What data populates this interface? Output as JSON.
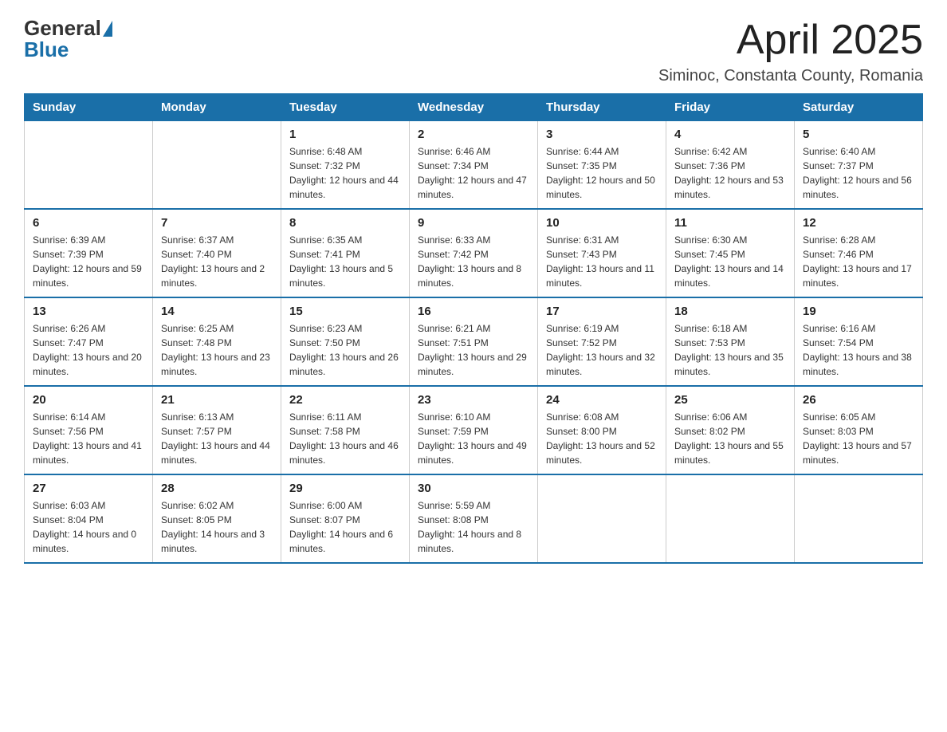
{
  "header": {
    "title": "April 2025",
    "subtitle": "Siminoc, Constanta County, Romania"
  },
  "logo": {
    "general": "General",
    "blue": "Blue"
  },
  "days_of_week": [
    "Sunday",
    "Monday",
    "Tuesday",
    "Wednesday",
    "Thursday",
    "Friday",
    "Saturday"
  ],
  "weeks": [
    [
      {
        "day": "",
        "sunrise": "",
        "sunset": "",
        "daylight": ""
      },
      {
        "day": "",
        "sunrise": "",
        "sunset": "",
        "daylight": ""
      },
      {
        "day": "1",
        "sunrise": "Sunrise: 6:48 AM",
        "sunset": "Sunset: 7:32 PM",
        "daylight": "Daylight: 12 hours and 44 minutes."
      },
      {
        "day": "2",
        "sunrise": "Sunrise: 6:46 AM",
        "sunset": "Sunset: 7:34 PM",
        "daylight": "Daylight: 12 hours and 47 minutes."
      },
      {
        "day": "3",
        "sunrise": "Sunrise: 6:44 AM",
        "sunset": "Sunset: 7:35 PM",
        "daylight": "Daylight: 12 hours and 50 minutes."
      },
      {
        "day": "4",
        "sunrise": "Sunrise: 6:42 AM",
        "sunset": "Sunset: 7:36 PM",
        "daylight": "Daylight: 12 hours and 53 minutes."
      },
      {
        "day": "5",
        "sunrise": "Sunrise: 6:40 AM",
        "sunset": "Sunset: 7:37 PM",
        "daylight": "Daylight: 12 hours and 56 minutes."
      }
    ],
    [
      {
        "day": "6",
        "sunrise": "Sunrise: 6:39 AM",
        "sunset": "Sunset: 7:39 PM",
        "daylight": "Daylight: 12 hours and 59 minutes."
      },
      {
        "day": "7",
        "sunrise": "Sunrise: 6:37 AM",
        "sunset": "Sunset: 7:40 PM",
        "daylight": "Daylight: 13 hours and 2 minutes."
      },
      {
        "day": "8",
        "sunrise": "Sunrise: 6:35 AM",
        "sunset": "Sunset: 7:41 PM",
        "daylight": "Daylight: 13 hours and 5 minutes."
      },
      {
        "day": "9",
        "sunrise": "Sunrise: 6:33 AM",
        "sunset": "Sunset: 7:42 PM",
        "daylight": "Daylight: 13 hours and 8 minutes."
      },
      {
        "day": "10",
        "sunrise": "Sunrise: 6:31 AM",
        "sunset": "Sunset: 7:43 PM",
        "daylight": "Daylight: 13 hours and 11 minutes."
      },
      {
        "day": "11",
        "sunrise": "Sunrise: 6:30 AM",
        "sunset": "Sunset: 7:45 PM",
        "daylight": "Daylight: 13 hours and 14 minutes."
      },
      {
        "day": "12",
        "sunrise": "Sunrise: 6:28 AM",
        "sunset": "Sunset: 7:46 PM",
        "daylight": "Daylight: 13 hours and 17 minutes."
      }
    ],
    [
      {
        "day": "13",
        "sunrise": "Sunrise: 6:26 AM",
        "sunset": "Sunset: 7:47 PM",
        "daylight": "Daylight: 13 hours and 20 minutes."
      },
      {
        "day": "14",
        "sunrise": "Sunrise: 6:25 AM",
        "sunset": "Sunset: 7:48 PM",
        "daylight": "Daylight: 13 hours and 23 minutes."
      },
      {
        "day": "15",
        "sunrise": "Sunrise: 6:23 AM",
        "sunset": "Sunset: 7:50 PM",
        "daylight": "Daylight: 13 hours and 26 minutes."
      },
      {
        "day": "16",
        "sunrise": "Sunrise: 6:21 AM",
        "sunset": "Sunset: 7:51 PM",
        "daylight": "Daylight: 13 hours and 29 minutes."
      },
      {
        "day": "17",
        "sunrise": "Sunrise: 6:19 AM",
        "sunset": "Sunset: 7:52 PM",
        "daylight": "Daylight: 13 hours and 32 minutes."
      },
      {
        "day": "18",
        "sunrise": "Sunrise: 6:18 AM",
        "sunset": "Sunset: 7:53 PM",
        "daylight": "Daylight: 13 hours and 35 minutes."
      },
      {
        "day": "19",
        "sunrise": "Sunrise: 6:16 AM",
        "sunset": "Sunset: 7:54 PM",
        "daylight": "Daylight: 13 hours and 38 minutes."
      }
    ],
    [
      {
        "day": "20",
        "sunrise": "Sunrise: 6:14 AM",
        "sunset": "Sunset: 7:56 PM",
        "daylight": "Daylight: 13 hours and 41 minutes."
      },
      {
        "day": "21",
        "sunrise": "Sunrise: 6:13 AM",
        "sunset": "Sunset: 7:57 PM",
        "daylight": "Daylight: 13 hours and 44 minutes."
      },
      {
        "day": "22",
        "sunrise": "Sunrise: 6:11 AM",
        "sunset": "Sunset: 7:58 PM",
        "daylight": "Daylight: 13 hours and 46 minutes."
      },
      {
        "day": "23",
        "sunrise": "Sunrise: 6:10 AM",
        "sunset": "Sunset: 7:59 PM",
        "daylight": "Daylight: 13 hours and 49 minutes."
      },
      {
        "day": "24",
        "sunrise": "Sunrise: 6:08 AM",
        "sunset": "Sunset: 8:00 PM",
        "daylight": "Daylight: 13 hours and 52 minutes."
      },
      {
        "day": "25",
        "sunrise": "Sunrise: 6:06 AM",
        "sunset": "Sunset: 8:02 PM",
        "daylight": "Daylight: 13 hours and 55 minutes."
      },
      {
        "day": "26",
        "sunrise": "Sunrise: 6:05 AM",
        "sunset": "Sunset: 8:03 PM",
        "daylight": "Daylight: 13 hours and 57 minutes."
      }
    ],
    [
      {
        "day": "27",
        "sunrise": "Sunrise: 6:03 AM",
        "sunset": "Sunset: 8:04 PM",
        "daylight": "Daylight: 14 hours and 0 minutes."
      },
      {
        "day": "28",
        "sunrise": "Sunrise: 6:02 AM",
        "sunset": "Sunset: 8:05 PM",
        "daylight": "Daylight: 14 hours and 3 minutes."
      },
      {
        "day": "29",
        "sunrise": "Sunrise: 6:00 AM",
        "sunset": "Sunset: 8:07 PM",
        "daylight": "Daylight: 14 hours and 6 minutes."
      },
      {
        "day": "30",
        "sunrise": "Sunrise: 5:59 AM",
        "sunset": "Sunset: 8:08 PM",
        "daylight": "Daylight: 14 hours and 8 minutes."
      },
      {
        "day": "",
        "sunrise": "",
        "sunset": "",
        "daylight": ""
      },
      {
        "day": "",
        "sunrise": "",
        "sunset": "",
        "daylight": ""
      },
      {
        "day": "",
        "sunrise": "",
        "sunset": "",
        "daylight": ""
      }
    ]
  ]
}
